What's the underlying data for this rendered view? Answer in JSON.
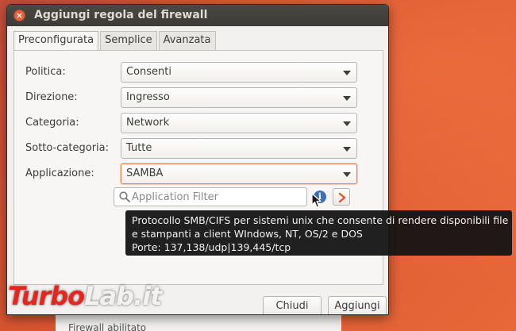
{
  "dialog": {
    "title": "Aggiungi regola del firewall"
  },
  "tabs": [
    {
      "label": "Preconfigurata",
      "active": true
    },
    {
      "label": "Semplice",
      "active": false
    },
    {
      "label": "Avanzata",
      "active": false
    }
  ],
  "form": {
    "politica": {
      "label": "Politica:",
      "value": "Consenti"
    },
    "direzione": {
      "label": "Direzione:",
      "value": "Ingresso"
    },
    "categoria": {
      "label": "Categoria:",
      "value": "Network"
    },
    "sotto_categoria": {
      "label": "Sotto-categoria:",
      "value": "Tutte"
    },
    "applicazione": {
      "label": "Applicazione:",
      "value": "SAMBA"
    }
  },
  "filter": {
    "placeholder": "Application Filter",
    "value": ""
  },
  "tooltip": {
    "line1": "Protocollo SMB/CIFS per sistemi unix che consente di rendere disponibili file",
    "line2": "e stampanti a client WIndows, NT, OS/2 e DOS",
    "line3": "Porte: 137,138/udp|139,445/tcp"
  },
  "buttons": {
    "close_label": "Chiudi",
    "add_label": "Aggiungi"
  },
  "background_window": {
    "status_text": "Firewall abilitato"
  },
  "watermark": {
    "part1": "Turbo",
    "part2": "Lab.it"
  },
  "colors": {
    "accent": "#e9814f",
    "titlebar": "#3c3b37",
    "close_button": "#e0603a",
    "info_icon": "#3f6fb0",
    "next_arrow": "#e05a2a"
  },
  "icons": {
    "search": "search-icon",
    "info": "info-icon",
    "next": "chevron-right-icon",
    "close": "close-icon"
  }
}
